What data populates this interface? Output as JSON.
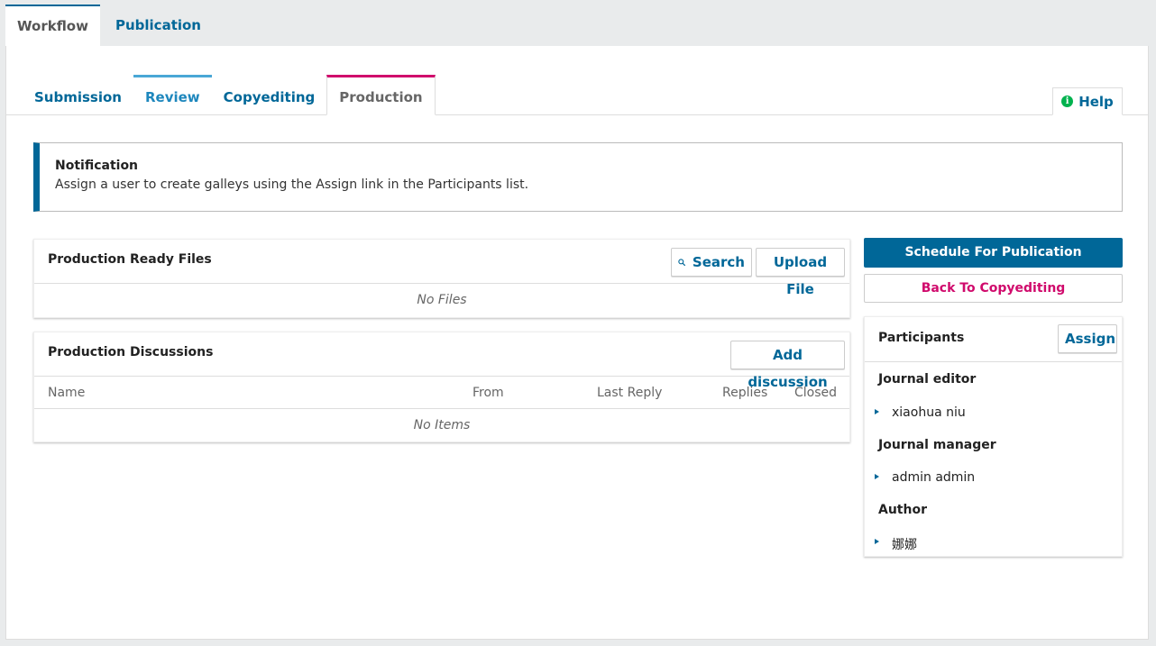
{
  "top_tabs": {
    "workflow": "Workflow",
    "publication": "Publication"
  },
  "stage_tabs": {
    "submission": "Submission",
    "review": "Review",
    "copyediting": "Copyediting",
    "production": "Production"
  },
  "help": {
    "label": "Help"
  },
  "notification": {
    "title": "Notification",
    "text": "Assign a user to create galleys using the Assign link in the Participants list."
  },
  "files_grid": {
    "title": "Production Ready Files",
    "search_label": "Search",
    "upload_label": "Upload File",
    "empty": "No Files"
  },
  "discussions_grid": {
    "title": "Production Discussions",
    "add_label": "Add discussion",
    "columns": [
      "Name",
      "From",
      "Last Reply",
      "Replies",
      "Closed"
    ],
    "empty": "No Items"
  },
  "actions": {
    "schedule_label": "Schedule For Publication",
    "back_label": "Back To Copyediting"
  },
  "participants": {
    "title": "Participants",
    "assign_label": "Assign",
    "groups": [
      {
        "role": "Journal editor",
        "members": [
          "xiaohua niu"
        ]
      },
      {
        "role": "Journal manager",
        "members": [
          "admin admin"
        ]
      },
      {
        "role": "Author",
        "members": [
          "娜娜"
        ]
      }
    ]
  },
  "colors": {
    "primary": "#006798",
    "accent": "#d00a6c",
    "info": "#00b24e"
  }
}
